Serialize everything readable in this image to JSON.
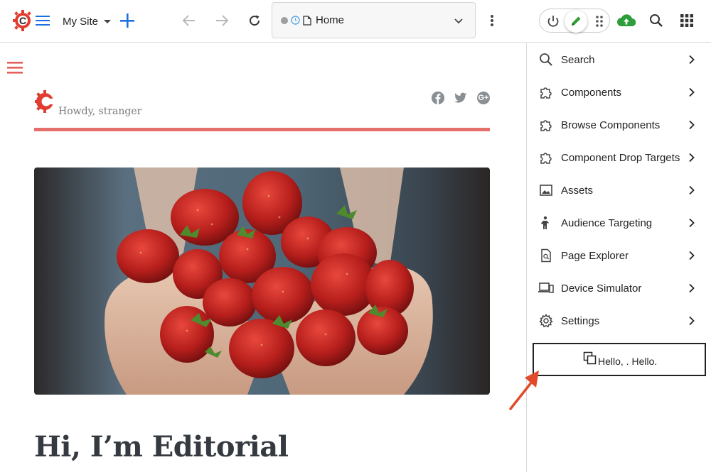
{
  "toolbar": {
    "site_name": "My Site",
    "address_label": "Home"
  },
  "preview": {
    "greeting": "Howdy, stranger",
    "post_title": "Hi, I’m Editorial",
    "social_google_label": "G+"
  },
  "panel": {
    "items": [
      {
        "label": "Search",
        "icon": "search-icon"
      },
      {
        "label": "Components",
        "icon": "puzzle-icon"
      },
      {
        "label": "Browse Components",
        "icon": "puzzle-icon"
      },
      {
        "label": "Component Drop Targets",
        "icon": "puzzle-icon"
      },
      {
        "label": "Assets",
        "icon": "image-icon"
      },
      {
        "label": "Audience Targeting",
        "icon": "person-icon"
      },
      {
        "label": "Page Explorer",
        "icon": "page-search-icon"
      },
      {
        "label": "Device Simulator",
        "icon": "devices-icon"
      },
      {
        "label": "Settings",
        "icon": "gear-icon"
      }
    ],
    "hello_text": "Hello, . Hello."
  },
  "colors": {
    "brand_red": "#e03c31",
    "accent_blue": "#1e6fe0",
    "edit_green": "#2e9e3b",
    "underline_coral": "#e5706b",
    "annotation_arrow": "#e04b2a"
  }
}
